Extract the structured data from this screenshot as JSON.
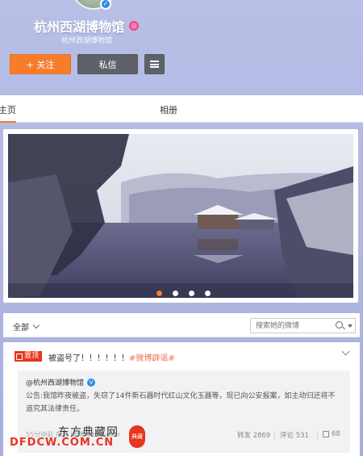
{
  "profile": {
    "name": "杭州西湖博物馆",
    "subname": "杭州西湖博物馆",
    "follow_label": "+ 关注",
    "message_label": "私信"
  },
  "tabs": {
    "home": "主页",
    "album": "相册"
  },
  "carousel": {
    "slide_count": 4,
    "active_index": 0
  },
  "filter": {
    "all_label": "全部",
    "search_placeholder": "搜索她的微博"
  },
  "post": {
    "pin_label": "置顶",
    "text": "被盗号了！！！！！！",
    "hashtag": "#微博辟谣#",
    "repost": {
      "user": "@杭州西湖博物馆",
      "body": "公告:我馆昨夜被盗，失窃了14件新石器时代红山文化玉器等，现已向公安报案，如主动归还将不追究其法律责任。",
      "meta": "55分钟前 来自 微博 weibo.com",
      "repost_label": "转发 2869",
      "comment_label": "评论 531",
      "like_count": "68"
    }
  },
  "watermark": {
    "cn": "东方典藏网",
    "en": "DFDCW.COM.CN",
    "seal": "典藏"
  },
  "colors": {
    "accent": "#f77d2b",
    "pin_red": "#e8351f",
    "hashtag": "#eb7350"
  }
}
